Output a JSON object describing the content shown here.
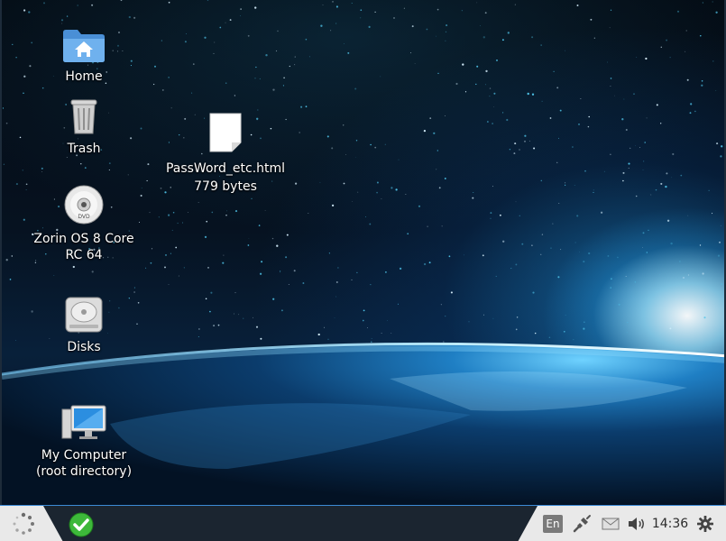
{
  "desktop": {
    "icons": [
      {
        "label": "Home",
        "icon": "home-folder-icon"
      },
      {
        "label": "Trash",
        "icon": "trash-icon"
      },
      {
        "label": "Zorin OS 8 Core RC 64",
        "icon": "optical-disc-icon"
      },
      {
        "label": "Disks",
        "icon": "hard-disk-icon"
      },
      {
        "label": "My Computer (root directory)",
        "icon": "computer-icon"
      }
    ],
    "file": {
      "name": "PassWord_etc.html",
      "size": "779 bytes",
      "icon": "html-file-icon"
    }
  },
  "taskbar": {
    "start_icon": "spinner-logo-icon",
    "app_icon": "green-check-icon",
    "tray": {
      "language": "En",
      "network_icon": "network-cable-icon",
      "mail_icon": "mail-icon",
      "volume_icon": "volume-icon",
      "clock": "14:36",
      "settings_icon": "gear-icon"
    },
    "colors": {
      "bar_light": "#e9e9e9",
      "bar_dark": "#1b2530",
      "accent": "#3c8ad6",
      "check_green": "#3db83a"
    }
  }
}
